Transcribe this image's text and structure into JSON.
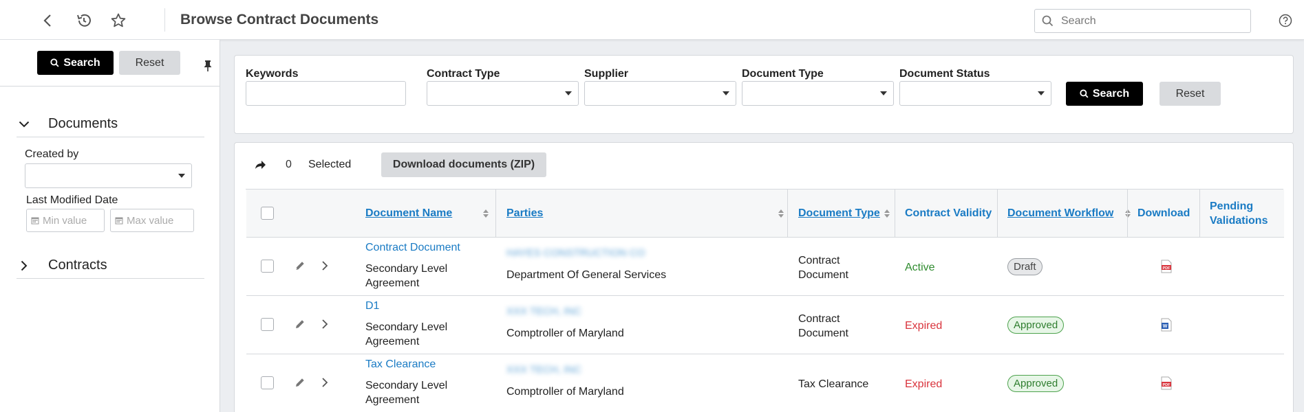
{
  "header": {
    "title": "Browse Contract Documents",
    "search_placeholder": "Search"
  },
  "sidebar": {
    "search_label": "Search",
    "reset_label": "Reset",
    "documents_section": "Documents",
    "created_by_label": "Created by",
    "last_modified_label": "Last Modified Date",
    "min_placeholder": "Min value",
    "max_placeholder": "Max value",
    "contracts_section": "Contracts"
  },
  "filters": {
    "keywords_label": "Keywords",
    "contract_type_label": "Contract Type",
    "supplier_label": "Supplier",
    "document_type_label": "Document Type",
    "document_status_label": "Document Status",
    "search_label": "Search",
    "reset_label": "Reset"
  },
  "results": {
    "selected_count": "0",
    "selected_label": "Selected",
    "download_zip_label": "Download documents (ZIP)",
    "columns": {
      "document_name": "Document Name",
      "parties": "Parties",
      "document_type": "Document Type",
      "contract_validity": "Contract Validity",
      "document_workflow": "Document Workflow",
      "download": "Download",
      "pending_validations_1": "Pending",
      "pending_validations_2": "Validations"
    },
    "rows": [
      {
        "name": "Contract Document",
        "sub1": "Secondary Level",
        "sub2": "Agreement",
        "party_hidden": "HAYES CONSTRUCTION CO",
        "party": "Department Of General Services",
        "type1": "Contract",
        "type2": "Document",
        "validity": "Active",
        "workflow": "Draft",
        "download_icon": "pdf-file-icon"
      },
      {
        "name": "D1",
        "sub1": "Secondary Level",
        "sub2": "Agreement",
        "party_hidden": "XXX TECH, INC",
        "party": "Comptroller of Maryland",
        "type1": "Contract",
        "type2": "Document",
        "validity": "Expired",
        "workflow": "Approved",
        "download_icon": "word-file-icon"
      },
      {
        "name": "Tax Clearance",
        "sub1": "Secondary Level",
        "sub2": "Agreement",
        "party_hidden": "XXX TECH, INC",
        "party": "Comptroller of Maryland",
        "type1": "Tax Clearance",
        "type2": "",
        "validity": "Expired",
        "workflow": "Approved",
        "download_icon": "pdf-file-icon"
      }
    ]
  },
  "colors": {
    "link": "#1a7bc4",
    "active": "#2e8b2e",
    "expired": "#d9333c",
    "primary_button": "#000000"
  }
}
